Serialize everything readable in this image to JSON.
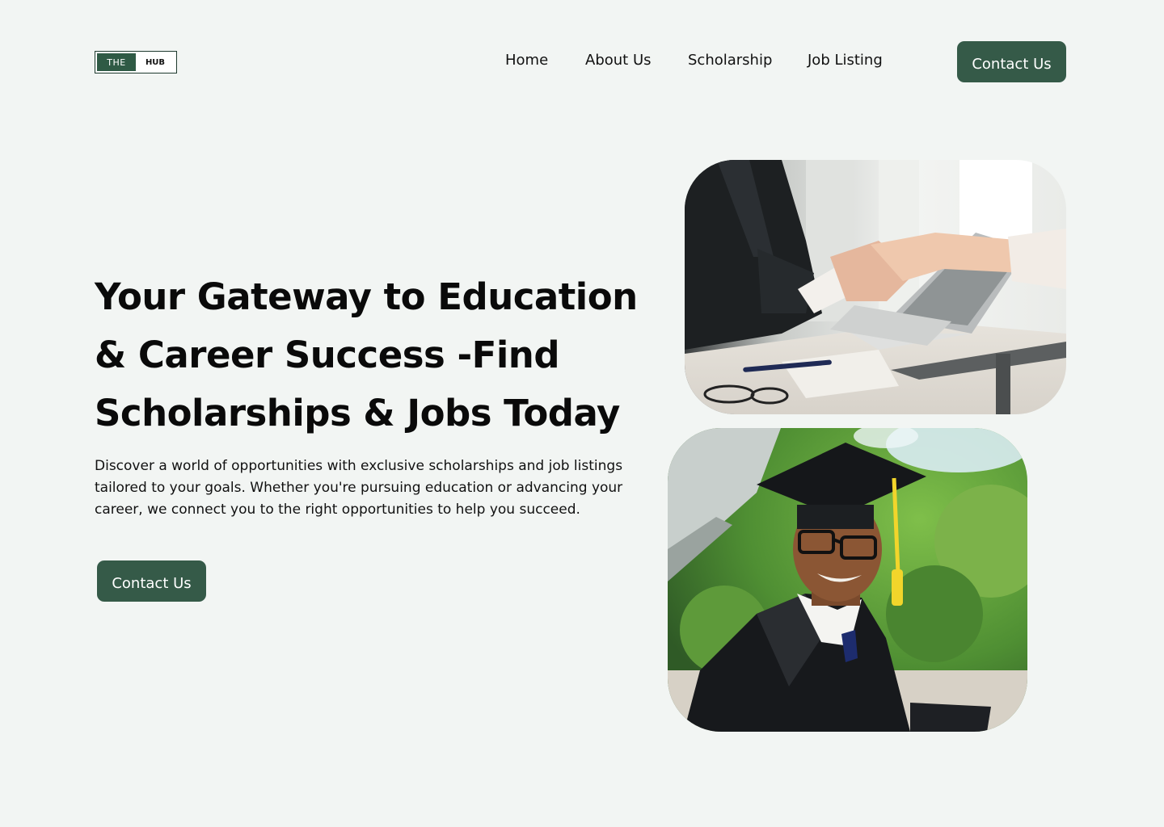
{
  "brand": {
    "logo_left": "THE",
    "logo_right": "HUB"
  },
  "nav": {
    "items": [
      "Home",
      "About Us",
      "Scholarship",
      "Job Listing"
    ],
    "cta_label": "Contact Us"
  },
  "hero": {
    "title": "Your Gateway to Education & Career Success -Find Scholarships & Jobs Today",
    "description": "Discover a world of opportunities with exclusive scholarships and job listings tailored to your goals. Whether you're pursuing education or advancing your career, we connect you to the right opportunities to help you succeed.",
    "cta_label": "Contact Us"
  },
  "images": {
    "top": "handshake-photo",
    "bottom": "graduate-photo"
  },
  "colors": {
    "background": "#f2f5f3",
    "accent": "#355a48",
    "logo_fill": "#2f5a45"
  }
}
